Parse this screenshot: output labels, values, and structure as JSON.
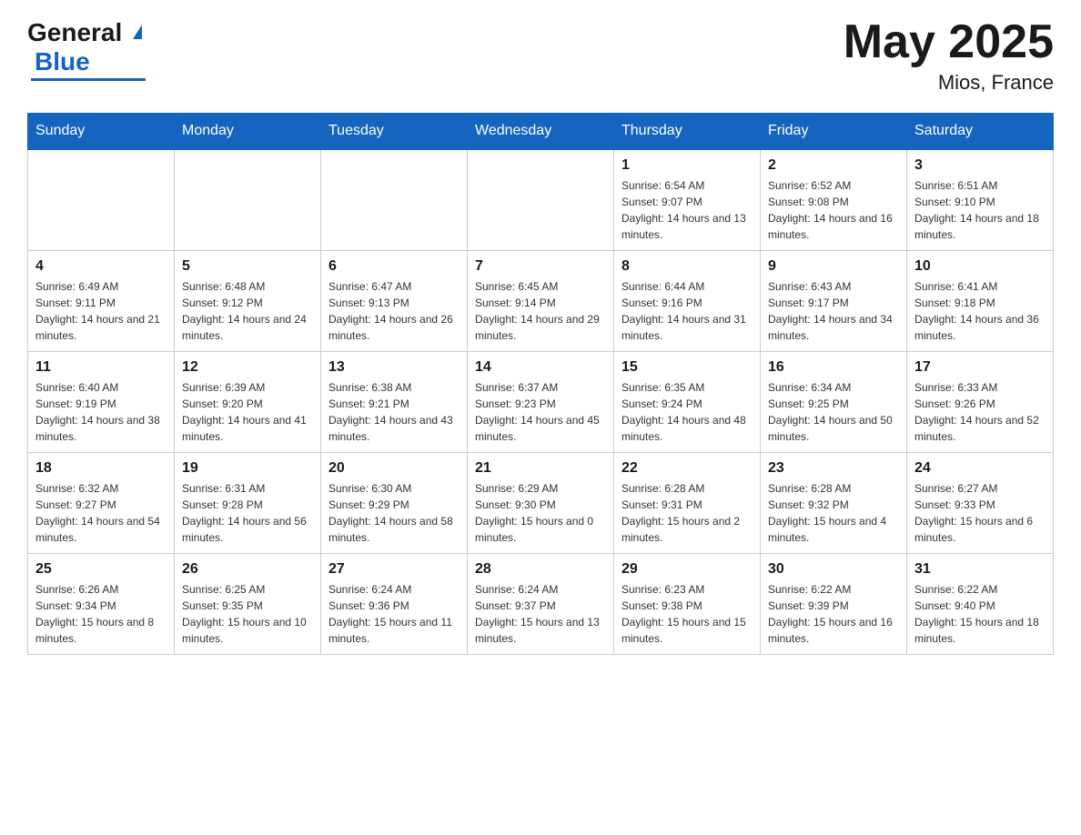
{
  "header": {
    "logo_general": "General",
    "logo_blue": "Blue",
    "month_title": "May 2025",
    "location": "Mios, France"
  },
  "weekdays": [
    "Sunday",
    "Monday",
    "Tuesday",
    "Wednesday",
    "Thursday",
    "Friday",
    "Saturday"
  ],
  "weeks": [
    [
      {
        "day": "",
        "info": ""
      },
      {
        "day": "",
        "info": ""
      },
      {
        "day": "",
        "info": ""
      },
      {
        "day": "",
        "info": ""
      },
      {
        "day": "1",
        "info": "Sunrise: 6:54 AM\nSunset: 9:07 PM\nDaylight: 14 hours and 13 minutes."
      },
      {
        "day": "2",
        "info": "Sunrise: 6:52 AM\nSunset: 9:08 PM\nDaylight: 14 hours and 16 minutes."
      },
      {
        "day": "3",
        "info": "Sunrise: 6:51 AM\nSunset: 9:10 PM\nDaylight: 14 hours and 18 minutes."
      }
    ],
    [
      {
        "day": "4",
        "info": "Sunrise: 6:49 AM\nSunset: 9:11 PM\nDaylight: 14 hours and 21 minutes."
      },
      {
        "day": "5",
        "info": "Sunrise: 6:48 AM\nSunset: 9:12 PM\nDaylight: 14 hours and 24 minutes."
      },
      {
        "day": "6",
        "info": "Sunrise: 6:47 AM\nSunset: 9:13 PM\nDaylight: 14 hours and 26 minutes."
      },
      {
        "day": "7",
        "info": "Sunrise: 6:45 AM\nSunset: 9:14 PM\nDaylight: 14 hours and 29 minutes."
      },
      {
        "day": "8",
        "info": "Sunrise: 6:44 AM\nSunset: 9:16 PM\nDaylight: 14 hours and 31 minutes."
      },
      {
        "day": "9",
        "info": "Sunrise: 6:43 AM\nSunset: 9:17 PM\nDaylight: 14 hours and 34 minutes."
      },
      {
        "day": "10",
        "info": "Sunrise: 6:41 AM\nSunset: 9:18 PM\nDaylight: 14 hours and 36 minutes."
      }
    ],
    [
      {
        "day": "11",
        "info": "Sunrise: 6:40 AM\nSunset: 9:19 PM\nDaylight: 14 hours and 38 minutes."
      },
      {
        "day": "12",
        "info": "Sunrise: 6:39 AM\nSunset: 9:20 PM\nDaylight: 14 hours and 41 minutes."
      },
      {
        "day": "13",
        "info": "Sunrise: 6:38 AM\nSunset: 9:21 PM\nDaylight: 14 hours and 43 minutes."
      },
      {
        "day": "14",
        "info": "Sunrise: 6:37 AM\nSunset: 9:23 PM\nDaylight: 14 hours and 45 minutes."
      },
      {
        "day": "15",
        "info": "Sunrise: 6:35 AM\nSunset: 9:24 PM\nDaylight: 14 hours and 48 minutes."
      },
      {
        "day": "16",
        "info": "Sunrise: 6:34 AM\nSunset: 9:25 PM\nDaylight: 14 hours and 50 minutes."
      },
      {
        "day": "17",
        "info": "Sunrise: 6:33 AM\nSunset: 9:26 PM\nDaylight: 14 hours and 52 minutes."
      }
    ],
    [
      {
        "day": "18",
        "info": "Sunrise: 6:32 AM\nSunset: 9:27 PM\nDaylight: 14 hours and 54 minutes."
      },
      {
        "day": "19",
        "info": "Sunrise: 6:31 AM\nSunset: 9:28 PM\nDaylight: 14 hours and 56 minutes."
      },
      {
        "day": "20",
        "info": "Sunrise: 6:30 AM\nSunset: 9:29 PM\nDaylight: 14 hours and 58 minutes."
      },
      {
        "day": "21",
        "info": "Sunrise: 6:29 AM\nSunset: 9:30 PM\nDaylight: 15 hours and 0 minutes."
      },
      {
        "day": "22",
        "info": "Sunrise: 6:28 AM\nSunset: 9:31 PM\nDaylight: 15 hours and 2 minutes."
      },
      {
        "day": "23",
        "info": "Sunrise: 6:28 AM\nSunset: 9:32 PM\nDaylight: 15 hours and 4 minutes."
      },
      {
        "day": "24",
        "info": "Sunrise: 6:27 AM\nSunset: 9:33 PM\nDaylight: 15 hours and 6 minutes."
      }
    ],
    [
      {
        "day": "25",
        "info": "Sunrise: 6:26 AM\nSunset: 9:34 PM\nDaylight: 15 hours and 8 minutes."
      },
      {
        "day": "26",
        "info": "Sunrise: 6:25 AM\nSunset: 9:35 PM\nDaylight: 15 hours and 10 minutes."
      },
      {
        "day": "27",
        "info": "Sunrise: 6:24 AM\nSunset: 9:36 PM\nDaylight: 15 hours and 11 minutes."
      },
      {
        "day": "28",
        "info": "Sunrise: 6:24 AM\nSunset: 9:37 PM\nDaylight: 15 hours and 13 minutes."
      },
      {
        "day": "29",
        "info": "Sunrise: 6:23 AM\nSunset: 9:38 PM\nDaylight: 15 hours and 15 minutes."
      },
      {
        "day": "30",
        "info": "Sunrise: 6:22 AM\nSunset: 9:39 PM\nDaylight: 15 hours and 16 minutes."
      },
      {
        "day": "31",
        "info": "Sunrise: 6:22 AM\nSunset: 9:40 PM\nDaylight: 15 hours and 18 minutes."
      }
    ]
  ]
}
